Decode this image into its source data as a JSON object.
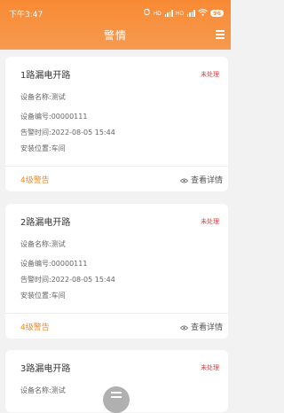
{
  "status_bar": {
    "time": "下午3:47",
    "sync_icon": "sync-icon",
    "signal1_label": "HD",
    "signal2_label": "HD",
    "wifi_icon": "wifi-icon",
    "battery": "96"
  },
  "header": {
    "title": "警情",
    "menu_icon": "hamburger-menu-icon"
  },
  "accent_color": "#f6923f",
  "alarms": [
    {
      "title": "1路漏电开路",
      "status": "未处理",
      "device_name_label": "设备名称:",
      "device_name": "测试",
      "device_id_label": "设备编号:",
      "device_id": "00000111",
      "alarm_time_label": "告警时间:",
      "alarm_time": "2022-08-05 15:44",
      "location_label": "安装位置:",
      "location": "车间",
      "level": "4级警告",
      "detail_label": "查看详情"
    },
    {
      "title": "2路漏电开路",
      "status": "未处理",
      "device_name_label": "设备名称:",
      "device_name": "测试",
      "device_id_label": "设备编号:",
      "device_id": "00000111",
      "alarm_time_label": "告警时间:",
      "alarm_time": "2022-08-05 15:44",
      "location_label": "安装位置:",
      "location": "车间",
      "level": "4级警告",
      "detail_label": "查看详情"
    },
    {
      "title": "3路漏电开路",
      "status": "未处理",
      "device_name_label": "设备名称:",
      "device_name": "测试"
    }
  ],
  "floating_button_icon": "list-menu-icon"
}
